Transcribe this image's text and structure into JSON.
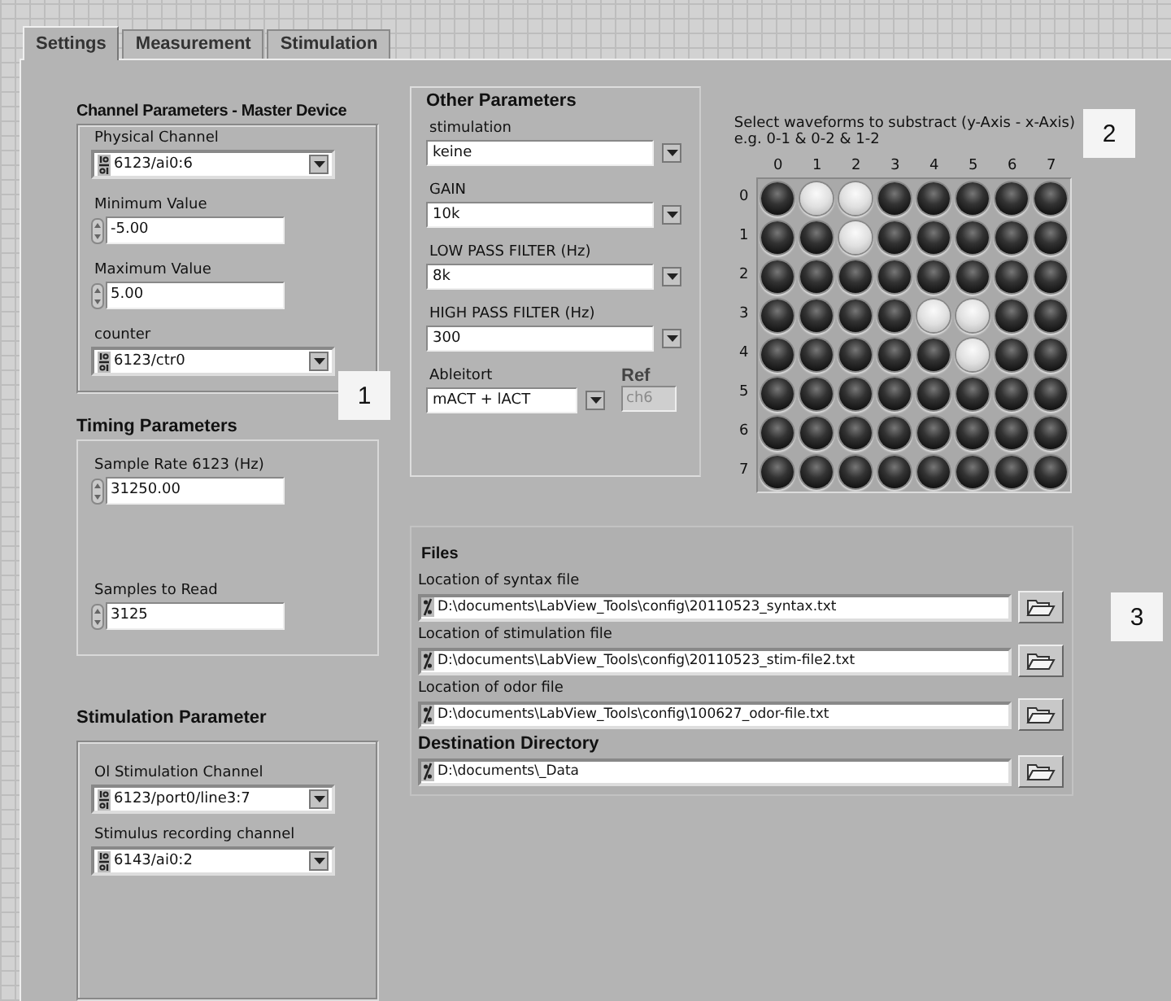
{
  "tabs": [
    {
      "label": "Settings",
      "selected": true
    },
    {
      "label": "Measurement",
      "selected": false
    },
    {
      "label": "Stimulation",
      "selected": false
    }
  ],
  "channel_parameters": {
    "title": "Channel Parameters - Master Device",
    "fields": [
      {
        "kind": "channel",
        "label": "Physical Channel",
        "value": "6123/ai0:6"
      },
      {
        "kind": "numeric",
        "label": "Minimum Value",
        "value": "-5.00"
      },
      {
        "kind": "numeric",
        "label": "Maximum Value",
        "value": "5.00"
      },
      {
        "kind": "channel",
        "label": "counter",
        "value": "6123/ctr0"
      }
    ]
  },
  "timing_parameters": {
    "title": "Timing Parameters",
    "fields": [
      {
        "kind": "numeric",
        "label": "Sample Rate 6123 (Hz)",
        "value": "31250.00"
      },
      {
        "kind": "numeric",
        "label": "Samples to Read",
        "value": "3125"
      }
    ]
  },
  "stimulation_parameter": {
    "title": "Stimulation Parameter",
    "fields": [
      {
        "kind": "channel",
        "label": "Ol Stimulation Channel",
        "value": "6123/port0/line3:7"
      },
      {
        "kind": "channel",
        "label": "Stimulus recording channel",
        "value": "6143/ai0:2"
      }
    ]
  },
  "other_parameters": {
    "title": "Other Parameters",
    "fields": [
      {
        "label": "stimulation",
        "value": "keine"
      },
      {
        "label": "GAIN",
        "value": "10k"
      },
      {
        "label": "LOW PASS FILTER (Hz)",
        "value": "8k"
      },
      {
        "label": "HIGH PASS FILTER (Hz)",
        "value": "300"
      },
      {
        "label": "Ableitort",
        "value": "mACT + lACT"
      }
    ],
    "ref": {
      "label": "Ref",
      "value": "ch6",
      "disabled": true
    }
  },
  "waveform_matrix": {
    "instruction": "Select waveforms to substract (y-Axis - x-Axis)",
    "example": "e.g.  0-1 & 0-2 & 1-2",
    "columns": [
      "0",
      "1",
      "2",
      "3",
      "4",
      "5",
      "6",
      "7"
    ],
    "rows": [
      {
        "label": "0",
        "cells": [
          {
            "on": false
          },
          {
            "on": true
          },
          {
            "on": true
          },
          {
            "on": false
          },
          {
            "on": false
          },
          {
            "on": false
          },
          {
            "on": false
          },
          {
            "on": false
          }
        ]
      },
      {
        "label": "1",
        "cells": [
          {
            "on": false
          },
          {
            "on": false
          },
          {
            "on": true
          },
          {
            "on": false
          },
          {
            "on": false
          },
          {
            "on": false
          },
          {
            "on": false
          },
          {
            "on": false
          }
        ]
      },
      {
        "label": "2",
        "cells": [
          {
            "on": false
          },
          {
            "on": false
          },
          {
            "on": false
          },
          {
            "on": false
          },
          {
            "on": false
          },
          {
            "on": false
          },
          {
            "on": false
          },
          {
            "on": false
          }
        ]
      },
      {
        "label": "3",
        "cells": [
          {
            "on": false
          },
          {
            "on": false
          },
          {
            "on": false
          },
          {
            "on": false
          },
          {
            "on": true
          },
          {
            "on": true
          },
          {
            "on": false
          },
          {
            "on": false
          }
        ]
      },
      {
        "label": "4",
        "cells": [
          {
            "on": false
          },
          {
            "on": false
          },
          {
            "on": false
          },
          {
            "on": false
          },
          {
            "on": false
          },
          {
            "on": true
          },
          {
            "on": false
          },
          {
            "on": false
          }
        ]
      },
      {
        "label": "5",
        "cells": [
          {
            "on": false
          },
          {
            "on": false
          },
          {
            "on": false
          },
          {
            "on": false
          },
          {
            "on": false
          },
          {
            "on": false
          },
          {
            "on": false
          },
          {
            "on": false
          }
        ]
      },
      {
        "label": "6",
        "cells": [
          {
            "on": false
          },
          {
            "on": false
          },
          {
            "on": false
          },
          {
            "on": false
          },
          {
            "on": false
          },
          {
            "on": false
          },
          {
            "on": false
          },
          {
            "on": false
          }
        ]
      },
      {
        "label": "7",
        "cells": [
          {
            "on": false
          },
          {
            "on": false
          },
          {
            "on": false
          },
          {
            "on": false
          },
          {
            "on": false
          },
          {
            "on": false
          },
          {
            "on": false
          },
          {
            "on": false
          }
        ]
      }
    ]
  },
  "files": {
    "title": "Files",
    "items": [
      {
        "label": "Location of syntax file",
        "value": "D:\\documents\\LabView_Tools\\config\\20110523_syntax.txt",
        "bold": false
      },
      {
        "label": "Location of stimulation file",
        "value": "D:\\documents\\LabView_Tools\\config\\20110523_stim-file2.txt",
        "bold": false
      },
      {
        "label": "Location of odor file",
        "value": "D:\\documents\\LabView_Tools\\config\\100627_odor-file.txt",
        "bold": false
      },
      {
        "label": "Destination Directory",
        "value": "D:\\documents\\_Data",
        "bold": true
      }
    ]
  },
  "callouts": [
    "1",
    "2",
    "3"
  ]
}
